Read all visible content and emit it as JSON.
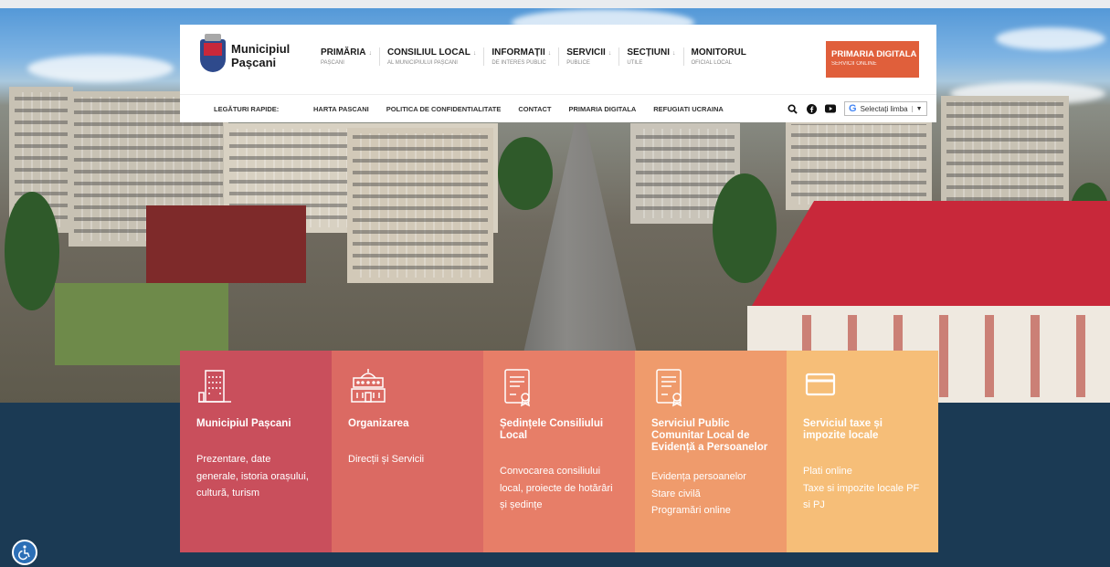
{
  "brand": {
    "line1": "Municipiul",
    "line2": "Pașcani"
  },
  "nav": [
    {
      "title": "PRIMĂRIA",
      "sub": "PAȘCANI"
    },
    {
      "title": "CONSILIUL LOCAL",
      "sub": "AL MUNICIPIULUI PAȘCANI"
    },
    {
      "title": "INFORMAȚII",
      "sub": "DE INTERES PUBLIC"
    },
    {
      "title": "SERVICII",
      "sub": "PUBLICE"
    },
    {
      "title": "SECȚIUNI",
      "sub": "UTILE"
    },
    {
      "title": "MONITORUL",
      "sub": "OFICIAL LOCAL"
    }
  ],
  "cta": {
    "title": "PRIMARIA DIGITALA",
    "sub": "SERVICII ONLINE",
    "color": "#e05f3b"
  },
  "quick": {
    "label": "LEGĂTURI RAPIDE:",
    "links": [
      "HARTA PASCANI",
      "POLITICA DE CONFIDENTIALITATE",
      "CONTACT",
      "PRIMARIA DIGITALA",
      "REFUGIATI UCRAINA"
    ]
  },
  "tools": {
    "search_icon": "search-icon",
    "facebook_icon": "facebook-icon",
    "youtube_icon": "youtube-icon",
    "language": "Selectați limba"
  },
  "cards": [
    {
      "title": "Municipiul Pașcani",
      "desc": "Prezentare, date generale, istoria orașului, cultură, turism",
      "color": "#c94f5c",
      "icon": "building-icon"
    },
    {
      "title": "Organizarea",
      "links": [
        "Direcții și Servicii"
      ],
      "color": "#db6a63",
      "icon": "city-hall-icon"
    },
    {
      "title": "Ședințele Consiliului Local",
      "desc": "Convocarea consiliului local, proiecte de hotărâri și ședințe",
      "color": "#e77e68",
      "icon": "document-icon"
    },
    {
      "title": "Serviciul Public Comunitar Local de Evidență a Persoanelor",
      "links": [
        "Evidența persoanelor",
        "Stare civilă",
        "Programări online"
      ],
      "color": "#ef9b6c",
      "icon": "document-icon"
    },
    {
      "title": "Serviciul taxe și impozite locale",
      "links": [
        "Plati online",
        "Taxe si impozite locale PF si PJ"
      ],
      "color": "#f6be78",
      "icon": "card-icon"
    }
  ],
  "accessibility_icon": "accessibility-icon",
  "band_color": "#1b3a54"
}
